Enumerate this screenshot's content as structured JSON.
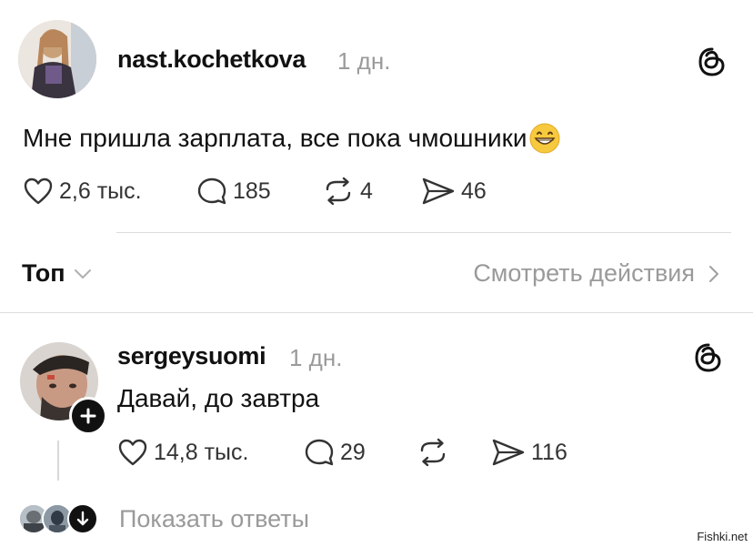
{
  "post": {
    "username": "nast.kochetkova",
    "time": "1 дн.",
    "text": "Мне пришла зарплата, все пока чмошники",
    "emoji": "😁",
    "stats": {
      "likes": "2,6 тыс.",
      "comments": "185",
      "reposts": "4",
      "shares": "46"
    }
  },
  "filter_bar": {
    "sort_label": "Топ",
    "activity_link": "Смотреть действия"
  },
  "reply": {
    "username": "sergeysuomi",
    "time": "1 дн.",
    "text": "Давай, до завтра",
    "stats": {
      "likes": "14,8 тыс.",
      "comments": "29",
      "shares": "116"
    }
  },
  "show_replies": {
    "label": "Показать ответы"
  },
  "watermark": "Fishki.net"
}
